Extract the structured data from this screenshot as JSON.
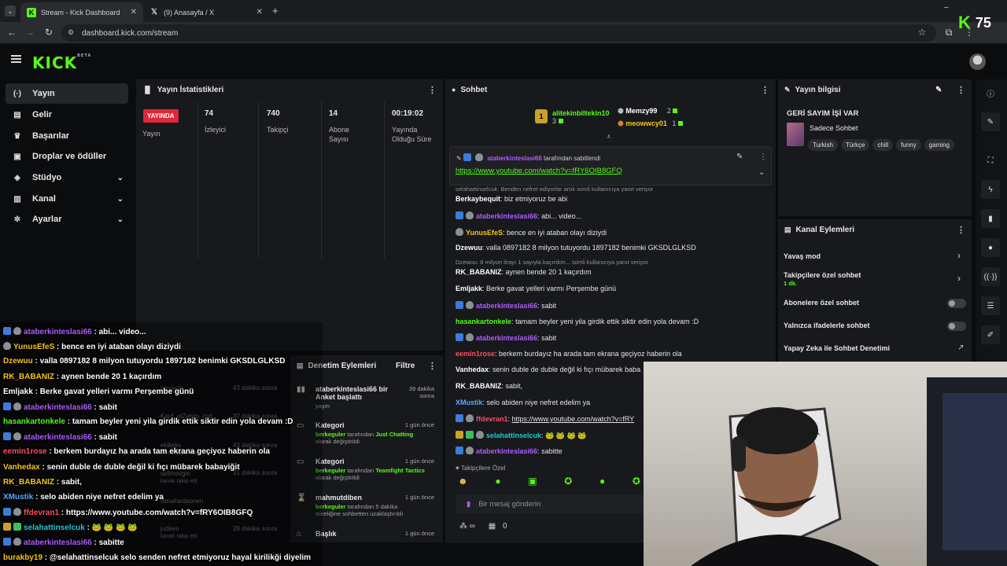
{
  "browser": {
    "tabs": [
      {
        "title": "Stream - Kick Dashboard",
        "active": true
      },
      {
        "title": "(9) Anasayfa / X",
        "active": false
      }
    ],
    "url": "dashboard.kick.com/stream",
    "viewer_count": "75"
  },
  "app": {
    "logo": "KICK",
    "logo_tag": "BETA"
  },
  "sidebar": {
    "items": [
      {
        "label": "Yayın",
        "icon": "broadcast-icon",
        "glyph": "(·)"
      },
      {
        "label": "Gelir",
        "icon": "revenue-icon",
        "glyph": "▤"
      },
      {
        "label": "Başarılar",
        "icon": "trophy-icon",
        "glyph": "♛"
      },
      {
        "label": "Droplar ve ödüller",
        "icon": "gift-icon",
        "glyph": "▣"
      },
      {
        "label": "Stüdyo",
        "icon": "studio-icon",
        "glyph": "◈"
      },
      {
        "label": "Kanal",
        "icon": "channel-icon",
        "glyph": "▥"
      },
      {
        "label": "Ayarlar",
        "icon": "settings-icon",
        "glyph": "✲"
      }
    ]
  },
  "stats": {
    "title": "Yayın İstatistikleri",
    "live_label": "YAYINDA",
    "broadcast_label": "Yayın",
    "viewers": {
      "value": "74",
      "label": "İzleyici"
    },
    "followers": {
      "value": "740",
      "label": "Takipçi"
    },
    "subscribers": {
      "value": "14",
      "label1": "Abone",
      "label2": "Sayısı"
    },
    "uptime": {
      "value": "00:19:02",
      "label1": "Yayında",
      "label2": "Olduğu Süre"
    }
  },
  "moderation": {
    "title": "Denetim Eylemleri",
    "filter": "Filtre",
    "items": [
      {
        "title": "ataberkinteslasi66 bir",
        "title2": "Anket başlattı",
        "desc": "",
        "time": "39 dakika",
        "time2": "sonra",
        "icon": "poll-icon",
        "glyph": "▮▮"
      },
      {
        "title": "Kategori",
        "user": "berkeguler",
        "desc1": "tarafından",
        "desc_hl": "Just Chatting",
        "desc2": "olarak değiştirildi",
        "time": "1 gün önce",
        "icon": "category-icon",
        "glyph": "▭"
      },
      {
        "title": "Kategori",
        "user": "berkeguler",
        "desc1": "tarafından",
        "desc_hl": "Teamfight Tactics",
        "desc2": "olarak değiştirildi",
        "time": "1 gün önce",
        "icon": "category-icon",
        "glyph": "▭"
      },
      {
        "title": "mahmutdiben",
        "user": "berkeguler",
        "desc1": "tarafından 5 dakika",
        "desc_hl": "",
        "desc2": "süreliğine sohbetten uzaklaştırıldı",
        "time": "1 gün önce",
        "icon": "timeout-icon",
        "glyph": "⌛"
      },
      {
        "title": "Başlık",
        "time": "1 gün önce",
        "icon": "title-icon",
        "glyph": "⌂"
      }
    ],
    "ghost_items": [
      {
        "name": "Umnet3",
        "time": "43 dakika sonra"
      },
      {
        "name": "Karif_alZahim_isid",
        "time": "37 dakika sonra"
      },
      {
        "name": "eklkkkv",
        "sub": "kanalı takip etti",
        "time": "43 dakika sonra"
      },
      {
        "name": "sellmevgin",
        "sub": "kanalı takip etti",
        "time": "31 dakika sonra"
      },
      {
        "name": "ismailardaonen",
        "time": ""
      },
      {
        "name": "judees",
        "sub": "kanalı takip etti",
        "time": "28 dakika sonra"
      }
    ]
  },
  "chat": {
    "title": "Sohbet",
    "top_gifters": [
      {
        "name": "alitekinbiltekin10",
        "count": "3"
      },
      {
        "name": "Memzy99",
        "count": "2"
      },
      {
        "name": "meowwcy01",
        "count": "1"
      }
    ],
    "pinned_by_user": "ataberkinteslasi66",
    "pinned_by_text": "tarafından sabitlendi",
    "pinned_link": "https://www.youtube.com/watch?v=fRY6OIB8GFQ",
    "reply1": "selahattinselcuk: Benden nefret ediyorlar artık isimli kullanıcıya yanıt veriyor",
    "messages": [
      {
        "user": "Berkaybequit",
        "color": "u-white",
        "text": "biz etmiyoruz be abi"
      },
      {
        "user": "ataberkinteslasi66",
        "color": "u-purple",
        "text": "abi... video..."
      },
      {
        "user": "YunusEfeS",
        "color": "u-yellow",
        "text": "bence en iyi ataban olayı diziydi"
      },
      {
        "user": "Dzewuu",
        "color": "u-white",
        "text": "valla 0897182 8 milyon tutuyordu 1897182 benimki GKSDLGLKSD"
      },
      {
        "user": "RK_BABANIZ",
        "color": "u-white",
        "text": "aynen bende 20 1 kaçırdım"
      },
      {
        "user": "Emljakk",
        "color": "u-white",
        "text": "Berke gavat yelleri varmı Perşembe günü"
      },
      {
        "user": "ataberkinteslasi66",
        "color": "u-purple",
        "text": "sabit"
      },
      {
        "user": "hasankartonkele",
        "color": "u-green",
        "text": "tamam beyler yeni yila girdik ettik siktir edin yola devam :D"
      },
      {
        "user": "ataberkinteslasi66",
        "color": "u-purple",
        "text": "sabit"
      },
      {
        "user": "eemin1rose",
        "color": "u-red",
        "text": "berkem burdayız ha arada tam ekrana geçiyoz haberin ola"
      },
      {
        "user": "Vanhedax",
        "color": "u-white",
        "text": "senin duble de duble değil ki fıçı mübarek baba"
      },
      {
        "user": "RK_BABANIZ",
        "color": "u-white",
        "text": "sabit,"
      },
      {
        "user": "XMustik",
        "color": "u-blue",
        "text": "selo abiden niye nefret edelim ya"
      },
      {
        "user": "ffdevran1",
        "color": "u-red",
        "text": "https://www.youtube.com/watch?v=fRY"
      },
      {
        "user": "selahattinselcuk",
        "color": "u-cyan",
        "text": "🐸 🐸 🐸 🐸"
      },
      {
        "user": "ataberkinteslasi66",
        "color": "u-purple",
        "text": "sabitte"
      }
    ],
    "reply2": "Dzewuu: 8 milyon lirayı 1 sayıyla kaçırdım... isimli kullanıcıya yanıt veriyor",
    "followers_only": "Takipçilere Özel",
    "placeholder": "Bir mesaj gönderin",
    "bottom_count": "0",
    "infinity": "∞"
  },
  "stream_info": {
    "title": "Yayın bilgisi",
    "stream_title": "GERİ SAYIM İŞİ VAR",
    "category": "Sadece Sohbet",
    "tags": [
      "Turkish",
      "Türkçe",
      "chill",
      "funny",
      "gaming"
    ]
  },
  "channel_actions": {
    "title": "Kanal Eylemleri",
    "slow_mode": "Yavaş mod",
    "followers_chat": "Takipçilere özel sohbet",
    "followers_chat_sub": "1 dk.",
    "subs_chat": "Abonelere özel sohbet",
    "emotes_chat": "Yalnızca ifadelerle sohbet",
    "ai_moderation": "Yapay Zeka ile Sohbet Denetimi"
  },
  "overlay_chat": [
    {
      "user": "ataberkinteslasi66",
      "color": "u-purple",
      "text": "abi... video..."
    },
    {
      "user": "YunusEfeS",
      "color": "u-yellow",
      "text": "bence en iyi ataban olayı diziydi"
    },
    {
      "user": "Dzewuu",
      "color": "u-yellow",
      "text": "valla 0897182 8 milyon tutuyordu 1897182 benimki GKSDLGLKSD"
    },
    {
      "user": "RK_BABANIZ",
      "color": "u-yellow",
      "text": "aynen bende 20 1 kaçırdım"
    },
    {
      "user": "Emljakk",
      "color": "u-white",
      "text": "Berke gavat yelleri varmı Perşembe günü"
    },
    {
      "user": "ataberkinteslasi66",
      "color": "u-purple",
      "text": "sabit"
    },
    {
      "user": "hasankartonkele",
      "color": "u-green",
      "text": "tamam beyler yeni yila girdik ettik siktir edin yola devam :D"
    },
    {
      "user": "ataberkinteslasi66",
      "color": "u-purple",
      "text": "sabit"
    },
    {
      "user": "eemin1rose",
      "color": "u-red",
      "text": "berkem burdayız ha arada tam ekrana geçiyoz haberin ola"
    },
    {
      "user": "Vanhedax",
      "color": "u-yellow",
      "text": "senin duble de duble değil ki fıçı mübarek babayiğit"
    },
    {
      "user": "RK_BABANIZ",
      "color": "u-yellow",
      "text": "sabit,"
    },
    {
      "user": "XMustik",
      "color": "u-blue",
      "text": "selo abiden niye nefret edelim ya"
    },
    {
      "user": "ffdevran1",
      "color": "u-red",
      "text": "https://www.youtube.com/watch?v=fRY6OIB8GFQ"
    },
    {
      "user": "selahattinselcuk",
      "color": "u-cyan",
      "text": "🐸 🐸 🐸 🐸"
    },
    {
      "user": "ataberkinteslasi66",
      "color": "u-purple",
      "text": "sabitte"
    },
    {
      "user": "burakby19",
      "color": "u-yellow",
      "text": "@selahattinselcuk selo senden nefret etmiyoruz hayal kirilikği diyelim"
    }
  ],
  "colors": {
    "accent": "#53fc18",
    "live": "#e0283a",
    "panel": "#18191c",
    "bg": "#0b0c0e"
  }
}
